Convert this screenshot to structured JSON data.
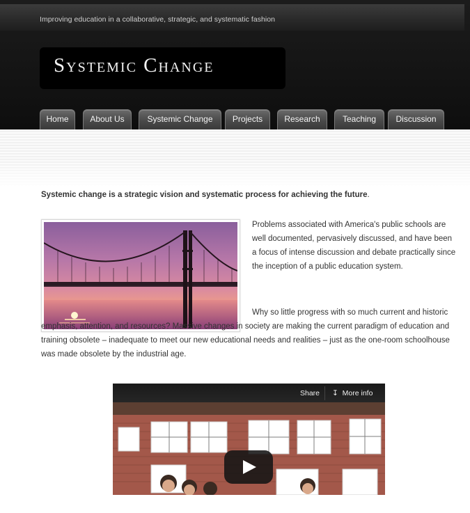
{
  "site": {
    "tagline": "Improving education in a collaborative, strategic, and systematic fashion",
    "logo_text": "Systemic Change"
  },
  "nav": {
    "tabs": [
      {
        "label": "Home"
      },
      {
        "label": "About Us"
      },
      {
        "label": "Systemic Change"
      },
      {
        "label": "Projects"
      },
      {
        "label": "Research"
      },
      {
        "label": "Teaching"
      },
      {
        "label": "Discussion"
      }
    ]
  },
  "main": {
    "intro_bold": "Systemic change is a strategic vision and systematic process for achieving the future",
    "intro_period": ".",
    "paragraph1": " Problems associated with America's public schools are well documented, pervasively discussed, and have been a focus of intense discussion and debate practically since the inception of a public education system.",
    "paragraph2": "Why so little progress with so much current and historic emphasis, attention, and resources? Massive changes in society are making the current paradigm of education and training obsolete – inadequate to meet our new educational needs and realities – just as the one-room schoolhouse was made obsolete by the industrial age."
  },
  "video": {
    "share_label": "Share",
    "more_info_label": "More info",
    "more_info_icon": "double-chevron-down-icon"
  },
  "colors": {
    "header_bg": "#111111",
    "tab_bg": "#4a4a4a",
    "text": "#333333"
  }
}
